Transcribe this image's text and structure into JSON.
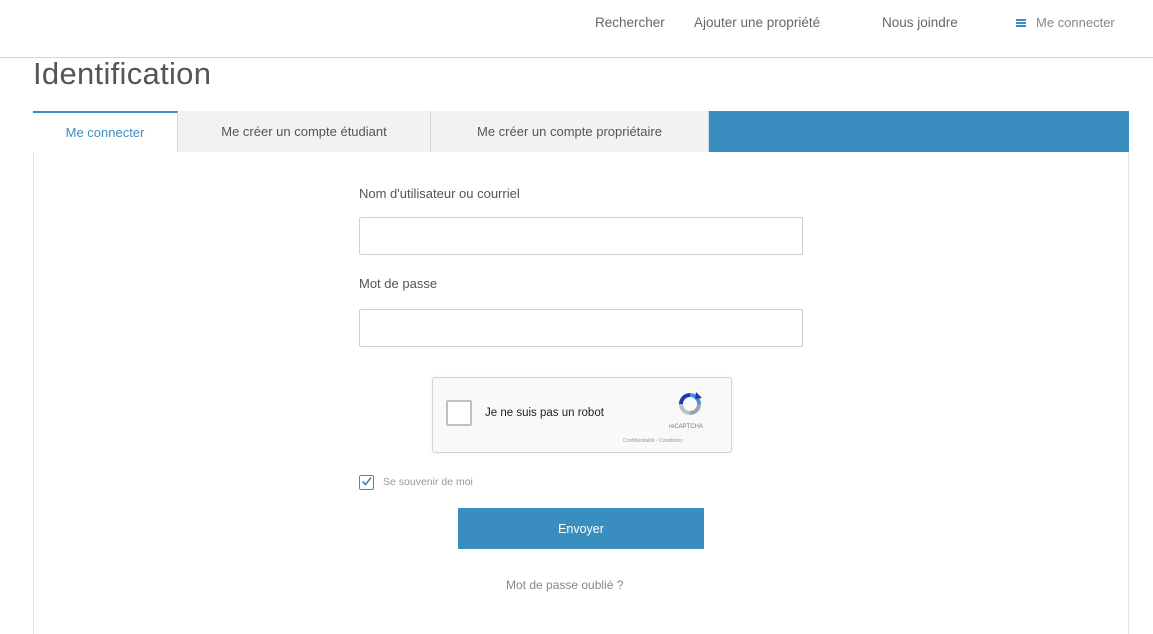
{
  "nav": {
    "search": "Rechercher",
    "add_property": "Ajouter une propriété",
    "contact": "Nous joindre",
    "login": "Me connecter",
    "login_icon": "menu-icon"
  },
  "page": {
    "title": "Identification"
  },
  "tabs": [
    {
      "label": "Me connecter",
      "active": true
    },
    {
      "label": "Me créer un compte étudiant",
      "active": false
    },
    {
      "label": "Me créer un compte propriétaire",
      "active": false
    }
  ],
  "form": {
    "username_label": "Nom d'utilisateur ou courriel",
    "username_value": "",
    "password_label": "Mot de passe",
    "password_value": "",
    "remember_label": "Se souvenir de moi",
    "remember_checked": true,
    "submit_label": "Envoyer",
    "forgot_label": "Mot de passe oublié ?"
  },
  "captcha": {
    "label": "Je ne suis pas un robot",
    "brand": "reCAPTCHA",
    "terms": "Confidentialité - Conditions",
    "icon": "recaptcha-logo-icon"
  },
  "colors": {
    "accent": "#3a8dbf",
    "tab_inactive": "#f2f2f2",
    "border": "#cfcfcf"
  }
}
